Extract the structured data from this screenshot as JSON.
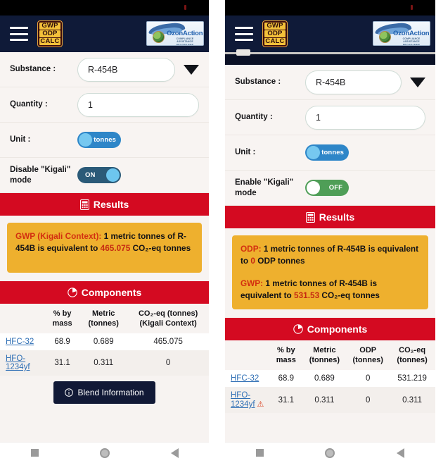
{
  "app": {
    "brand_lines": [
      "GWP",
      "ODP",
      "CALC"
    ],
    "partner_logo_text": "OzonAction",
    "partner_logo_subtext": "COMPLIANCE ASSISTANCE PROGRAMME"
  },
  "left": {
    "form": {
      "substance_label": "Substance :",
      "substance_value": "R-454B",
      "quantity_label": "Quantity :",
      "quantity_value": "1",
      "unit_label": "Unit :",
      "unit_toggle_text": "tonnes",
      "kigali_label": "Disable \"Kigali\" mode",
      "kigali_toggle_text": "ON"
    },
    "results": {
      "header": "Results",
      "lines": [
        {
          "key": "GWP (Kigali Context):",
          "text_before": " 1 metric tonnes of R-454B is equivalent to ",
          "value": "465.075",
          "text_after": " CO₂-eq tonnes"
        }
      ]
    },
    "components": {
      "header": "Components",
      "columns": [
        "",
        "% by mass",
        "Metric (tonnes)",
        "CO₂-eq (tonnes) (Kigali Context)"
      ],
      "rows": [
        {
          "name": "HFC-32",
          "mass": "68.9",
          "metric": "0.689",
          "co2": "465.075",
          "warn": false
        },
        {
          "name": "HFO-1234yf",
          "mass": "31.1",
          "metric": "0.311",
          "co2": "0",
          "warn": false
        }
      ],
      "blend_button": "Blend Information"
    }
  },
  "right": {
    "form": {
      "substance_label": "Substance :",
      "substance_value": "R-454B",
      "quantity_label": "Quantity :",
      "quantity_value": "1",
      "unit_label": "Unit :",
      "unit_toggle_text": "tonnes",
      "kigali_label": "Enable \"Kigali\" mode",
      "kigali_toggle_text": "OFF"
    },
    "results": {
      "header": "Results",
      "odp": {
        "key": "ODP:",
        "text_before": " 1 metric tonnes of R-454B is equivalent to ",
        "value": "0",
        "text_after": " ODP tonnes"
      },
      "gwp": {
        "key": "GWP:",
        "text_before": " 1 metric tonnes of R-454B is equivalent to ",
        "value": "531.53",
        "text_after": " CO₂-eq tonnes"
      }
    },
    "components": {
      "header": "Components",
      "columns": [
        "",
        "% by mass",
        "Metric (tonnes)",
        "ODP (tonnes)",
        "CO₂-eq (tonnes)"
      ],
      "rows": [
        {
          "name": "HFC-32",
          "mass": "68.9",
          "metric": "0.689",
          "odp": "0",
          "co2": "531.219",
          "warn": false
        },
        {
          "name": "HFO-1234yf",
          "mass": "31.1",
          "metric": "0.311",
          "odp": "0",
          "co2": "0.311",
          "warn": true
        }
      ]
    }
  },
  "colors": {
    "accent_red": "#d40a21",
    "card_amber": "#eeb02e",
    "appbar_navy": "#0f1a38",
    "toggle_blue": "#2e86c8",
    "toggle_on": "#2b5a78",
    "toggle_off_green": "#4f9e57",
    "link_blue": "#2f6fb5"
  },
  "navbar": {
    "recents": "recents",
    "home": "home",
    "back": "back"
  }
}
